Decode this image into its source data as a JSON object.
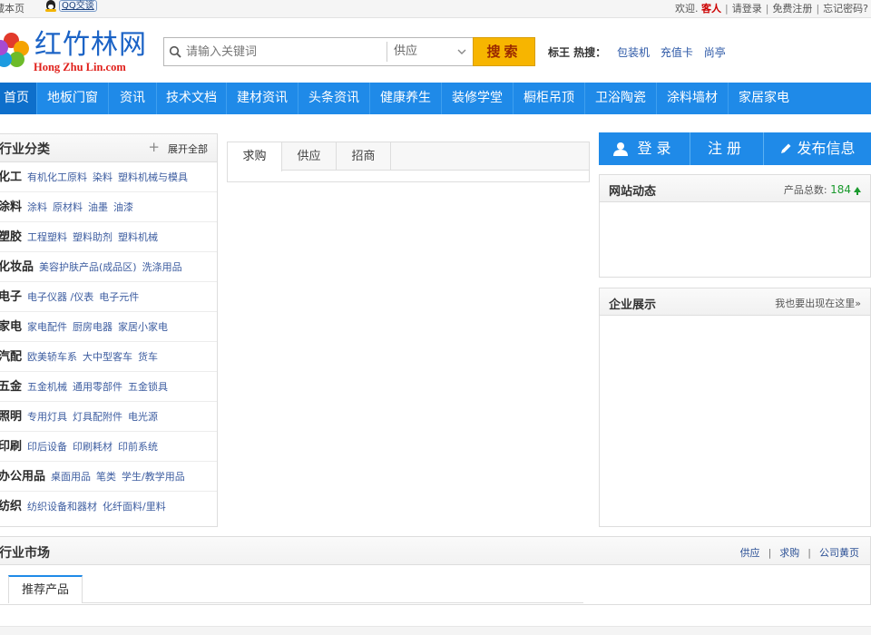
{
  "topbar": {
    "left_text": "藏本页",
    "qq_label": "QQ交谈",
    "welcome": "欢迎.",
    "guest": "客人",
    "login": "请登录",
    "register": "免费注册",
    "forgot": "忘记密码?"
  },
  "logo": {
    "cn": "红竹林网",
    "en": "Hong Zhu Lin.com",
    "petal_colors": [
      "#e23a2c",
      "#f5a300",
      "#6dbb2a",
      "#1d9be0",
      "#a74ad1"
    ]
  },
  "search": {
    "placeholder": "请输入关键词",
    "category": "供应",
    "button": "搜索"
  },
  "hot": {
    "label": "标王 热搜：",
    "keywords": [
      "包装机",
      "充值卡",
      "尚亭"
    ]
  },
  "nav": {
    "items": [
      "首页",
      "地板门窗",
      "资讯",
      "技术文档",
      "建材资讯",
      "头条资讯",
      "健康养生",
      "装修学堂",
      "橱柜吊顶",
      "卫浴陶瓷",
      "涂料墙材",
      "家居家电"
    ],
    "accent": "#1f8ae8"
  },
  "categories": {
    "title": "行业分类",
    "expand": "展开全部",
    "rows": [
      {
        "main": "化工",
        "subs": [
          "有机化工原料",
          "染料",
          "塑料机械与模具"
        ]
      },
      {
        "main": "涂料",
        "subs": [
          "涂料",
          "原材料",
          "油墨",
          "油漆"
        ]
      },
      {
        "main": "塑胶",
        "subs": [
          "工程塑料",
          "塑料助剂",
          "塑料机械"
        ]
      },
      {
        "main": "化妆品",
        "subs": [
          "美容护肤产品(成品区)",
          "洗涤用品"
        ]
      },
      {
        "main": "电子",
        "subs": [
          "电子仪器 /仪表",
          "电子元件"
        ]
      },
      {
        "main": "家电",
        "subs": [
          "家电配件",
          "厨房电器",
          "家居小家电"
        ]
      },
      {
        "main": "汽配",
        "subs": [
          "欧美轿车系",
          "大中型客车",
          "货车"
        ]
      },
      {
        "main": "五金",
        "subs": [
          "五金机械",
          "通用零部件",
          "五金锁具"
        ]
      },
      {
        "main": "照明",
        "subs": [
          "专用灯具",
          "灯具配附件",
          "电光源"
        ]
      },
      {
        "main": "印刷",
        "subs": [
          "印后设备",
          "印刷耗材",
          "印前系统"
        ]
      },
      {
        "main": "办公用品",
        "subs": [
          "桌面用品",
          "笔类",
          "学生/教学用品"
        ]
      },
      {
        "main": "纺织",
        "subs": [
          "纺织设备和器材",
          "化纤面料/里料"
        ]
      }
    ]
  },
  "trade_tabs": [
    "求购",
    "供应",
    "招商"
  ],
  "account": {
    "login": "登录",
    "register": "注册",
    "publish": "发布信息"
  },
  "site_news": {
    "title": "网站动态",
    "count_label": "产品总数:",
    "count": "184"
  },
  "showcase": {
    "title": "企业展示",
    "link": "我也要出现在这里»"
  },
  "market": {
    "title": "行业市场",
    "links": [
      "供应",
      "求购",
      "公司黄页"
    ],
    "tab": "推荐产品"
  }
}
